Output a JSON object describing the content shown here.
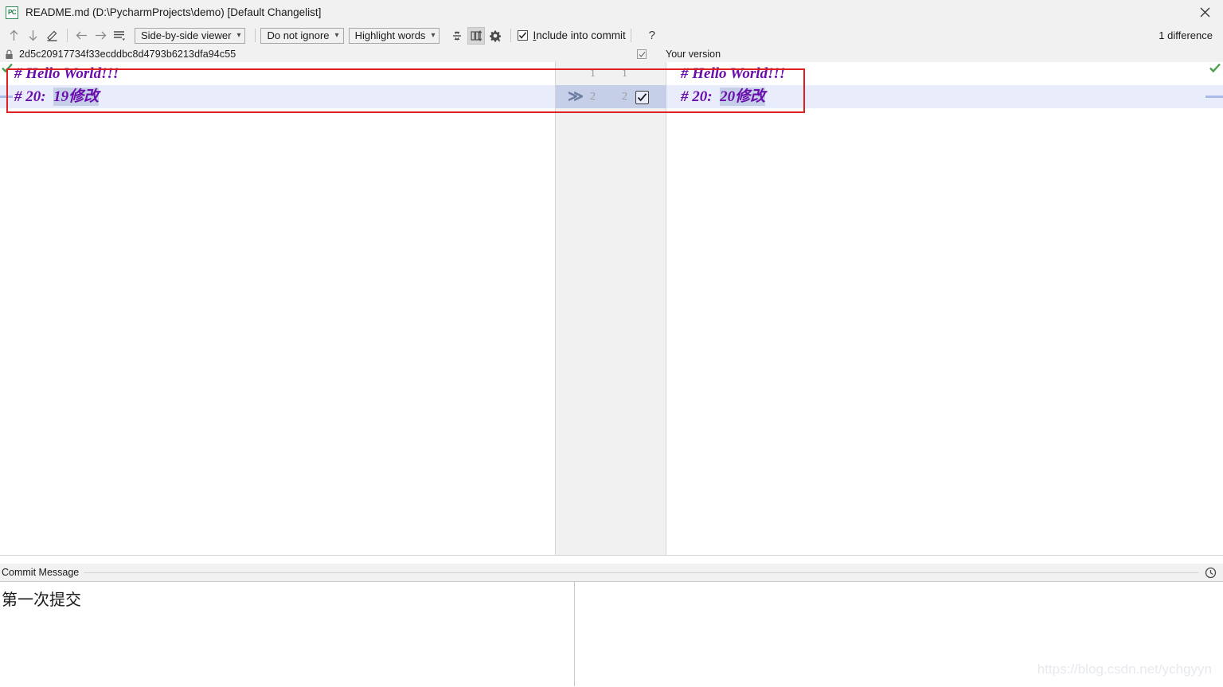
{
  "window": {
    "app_icon": "pycharm-icon",
    "title": "README.md (D:\\PycharmProjects\\demo) [Default Changelist]",
    "close_label": "×"
  },
  "toolbar": {
    "icons": [
      {
        "name": "previous-difference-icon",
        "glyph": "↑"
      },
      {
        "name": "next-difference-icon",
        "glyph": "↓"
      },
      {
        "name": "edit-source-icon",
        "glyph": "✎"
      },
      {
        "name": "previous-change-icon",
        "glyph": "←"
      },
      {
        "name": "next-change-icon",
        "glyph": "→"
      },
      {
        "name": "lines-options-icon",
        "glyph": "≡"
      }
    ],
    "viewer_mode": "Side-by-side viewer",
    "ignore_mode": "Do not ignore",
    "highlight_mode": "Highlight words",
    "collapse_unchanged_icon": "collapse-unchanged-fragments-icon",
    "synchronize_scroll_icon": "synchronize-scroll-icon",
    "settings_icon": "gear-icon",
    "include_into_commit_label": "Include into commit",
    "include_into_commit_mnemonic": "I",
    "include_into_commit_rest": "nclude into commit",
    "include_into_commit_checked": true,
    "help_label": "?",
    "difference_count": "1 difference"
  },
  "diff_header": {
    "lock_icon": "lock-icon",
    "revision_hash": "2d5c20917734f33ecddbc8d4793b6213dfa94c55",
    "right_checkbox_checked": true,
    "right_title": "Your version"
  },
  "diff": {
    "left": {
      "lines": [
        {
          "num": "1",
          "prefix": "# Hello World!!!",
          "highlight": "",
          "suffix": "",
          "changed": false
        },
        {
          "num": "2",
          "prefix": "# 20:  ",
          "highlight": "19修改",
          "suffix": "",
          "changed": true
        }
      ]
    },
    "right": {
      "lines": [
        {
          "num": "1",
          "prefix": "# Hello World!!!",
          "highlight": "",
          "suffix": "",
          "changed": false
        },
        {
          "num": "2",
          "prefix": "# 20:  ",
          "highlight": "20修改",
          "suffix": "",
          "changed": true
        }
      ]
    },
    "gutter": {
      "apply_arrow_glyph": "≫",
      "apply_arrow_name": "accept-change-arrow-icon",
      "row_checkbox_checked": true
    },
    "markers": {
      "left_status_icon": "ok-check-icon",
      "right_status_icon": "ok-check-icon",
      "change_marker_color": "#a9bbe8"
    }
  },
  "annotations": {
    "highlight_box_color": "#e02020"
  },
  "commit": {
    "section_label": "Commit Message",
    "history_icon": "clock-history-icon",
    "message_value": "第一次提交",
    "message_placeholder": ""
  },
  "watermark": {
    "text": "https://blog.csdn.net/ychgyyn"
  },
  "colors": {
    "toolbar_bg": "#f1f1f1",
    "changed_row_bg": "#e8ecfb",
    "word_highlight_bg": "#c5cfe8",
    "gutter_highlight_bg": "#c5cfe8",
    "code_text": "#6a0dad",
    "ok_green": "#47a04e"
  }
}
